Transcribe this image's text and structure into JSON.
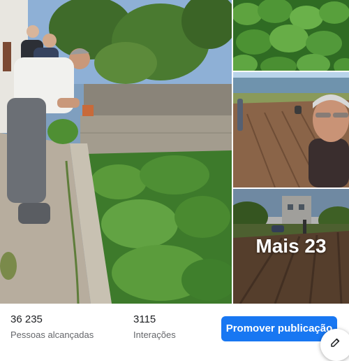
{
  "post": {
    "images": [
      {
        "name": "main-photo",
        "alt": "gardening"
      },
      {
        "name": "greens-photo",
        "alt": "greens"
      },
      {
        "name": "selfie-photo",
        "alt": "field"
      },
      {
        "name": "field-photo",
        "alt": "field"
      }
    ],
    "more_photos_label": "Mais 23"
  },
  "insights": {
    "reach_value": "36 235",
    "reach_label": "Pessoas alcançadas",
    "interactions_value": "3115",
    "interactions_label": "Interações"
  },
  "actions": {
    "promote_label": "Promover publicação",
    "edit_icon": "edit-icon"
  },
  "colors": {
    "accent": "#1877f2",
    "text_primary": "#1c1e21",
    "text_secondary": "#65676b"
  }
}
